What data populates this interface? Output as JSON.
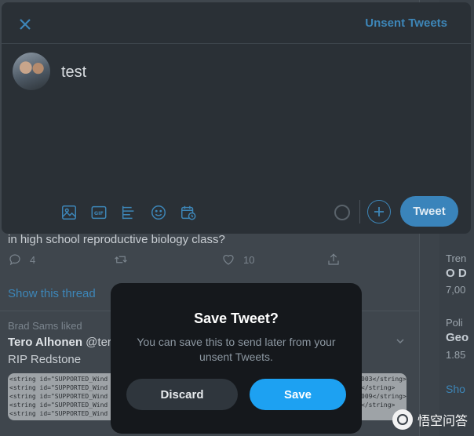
{
  "compose": {
    "unsent_link": "Unsent Tweets",
    "text": "test",
    "tweet_button": "Tweet",
    "toolbar_icons": [
      "image-icon",
      "gif-icon",
      "poll-icon",
      "emoji-icon",
      "schedule-icon"
    ]
  },
  "timeline": {
    "tweet_text": "in high school reproductive biology class?",
    "reply_count": "4",
    "like_count": "10",
    "show_thread": "Show this thread",
    "liked_by": "Brad Sams liked",
    "author_name": "Tero Alhonen",
    "author_handle": "@ter",
    "tweet2_text": "RIP Redstone",
    "code_lines": [
      "<string id=\"SUPPORTED_Wind",
      "<string id=\"SUPPORTED_Wind",
      "<string id=\"SUPPORTED_Wind",
      "<string id=\"SUPPORTED_Wind",
      "<string id=\"SUPPORTED_Wind"
    ],
    "code_lines_right": [
      "003</string>",
      "</string>",
      "009</string>",
      "</string>",
      ""
    ]
  },
  "sidebar": {
    "trend_label": "Tren",
    "trend_title": "O D",
    "trend_count": "7,00",
    "trend2_label": "Poli",
    "trend2_title": "Geo",
    "trend2_count": "1.85",
    "show_more": "Sho"
  },
  "dialog": {
    "title": "Save Tweet?",
    "message": "You can save this to send later from your unsent Tweets.",
    "discard_label": "Discard",
    "save_label": "Save"
  },
  "watermark": {
    "text": "悟空问答"
  },
  "colors": {
    "accent": "#1da1f2",
    "link": "#3d86b8",
    "modal_bg": "#2a3036",
    "dialog_bg": "#15181c"
  }
}
